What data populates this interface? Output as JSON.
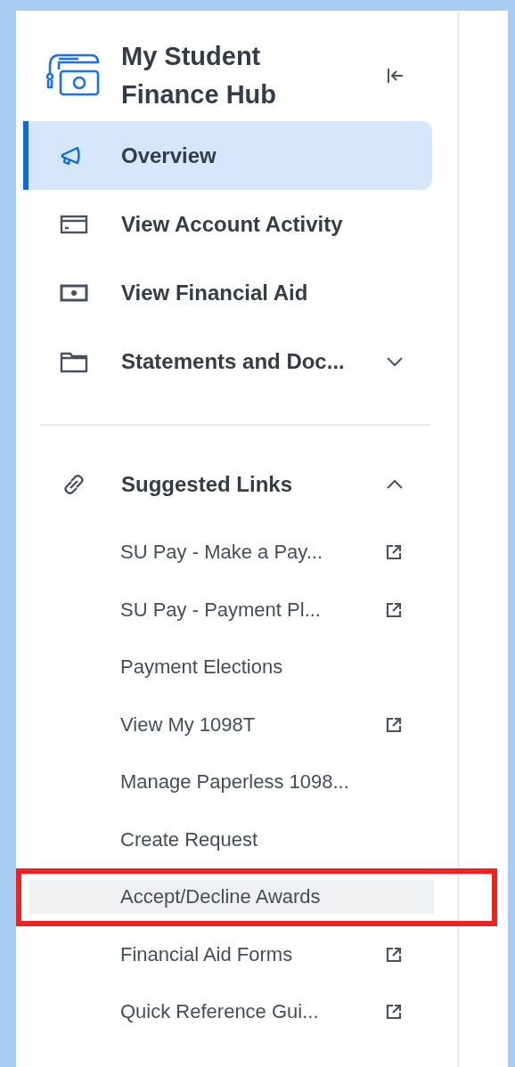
{
  "header": {
    "title_lines": [
      "My Student",
      "Finance Hub"
    ]
  },
  "nav_items": [
    {
      "label": "Overview",
      "selected": true
    },
    {
      "label": "View Account Activity",
      "selected": false
    },
    {
      "label": "View Financial Aid",
      "selected": false
    },
    {
      "label": "Statements and Doc...",
      "selected": false,
      "expanded": false
    }
  ],
  "suggested_links": {
    "label": "Suggested Links",
    "expanded": true,
    "links": [
      {
        "label": "SU Pay - Make a Pay...",
        "external": true,
        "hovered": false,
        "outlined": false
      },
      {
        "label": "SU Pay - Payment Pl...",
        "external": true,
        "hovered": false,
        "outlined": false
      },
      {
        "label": "Payment Elections",
        "external": false,
        "hovered": false,
        "outlined": false
      },
      {
        "label": "View My 1098T",
        "external": true,
        "hovered": false,
        "outlined": false
      },
      {
        "label": "Manage Paperless 1098...",
        "external": false,
        "hovered": false,
        "outlined": false
      },
      {
        "label": "Create Request",
        "external": false,
        "hovered": false,
        "outlined": false
      },
      {
        "label": "Accept/Decline Awards",
        "external": false,
        "hovered": true,
        "outlined": true
      },
      {
        "label": "Financial Aid Forms",
        "external": true,
        "hovered": false,
        "outlined": false
      },
      {
        "label": "Quick Reference Gui...",
        "external": true,
        "hovered": false,
        "outlined": false
      }
    ]
  }
}
